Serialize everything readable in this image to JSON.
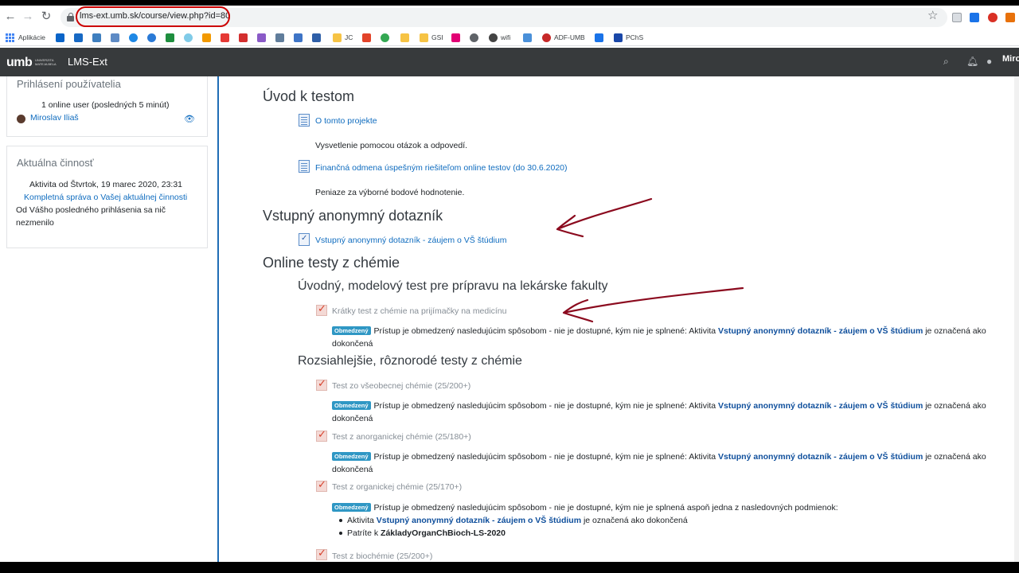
{
  "browser": {
    "url": "lms-ext.umb.sk/course/view.php?id=80",
    "bookmarks": [
      "Aplikácie",
      "JC",
      "GSI",
      "wifi",
      "ADF-UMB",
      "PChS"
    ]
  },
  "navbar": {
    "site_name": "LMS-Ext",
    "logo_text": "umb",
    "logo_sub": "UNIVERZITA MATEJA BELA",
    "user": "Miro"
  },
  "blocks": {
    "login": {
      "title": "Prihlásení používatelia",
      "count": "1 online user (posledných 5 minút)",
      "user": "Miroslav Iliaš"
    },
    "activity": {
      "title": "Aktuálna činnosť",
      "since": "Aktivita od Štvrtok, 19 marec 2020, 23:31",
      "report_link": "Kompletná správa o Vašej aktuálnej činnosti",
      "nothing": "Od Vášho posledného prihlásenia sa nič",
      "nothing2": "nezmenilo"
    }
  },
  "course": {
    "s1": {
      "title": "Úvod k testom",
      "a1": "O tomto projekte",
      "d1": "Vysvetlenie pomocou otázok a odpovedí.",
      "a2": "Finančná odmena úspešným riešiteľom online testov (do 30.6.2020)",
      "d2": "Peniaze za výborné bodové hodnotenie."
    },
    "s2": {
      "title": "Vstupný anonymný dotazník",
      "a1": "Vstupný anonymný dotazník - záujem o VŠ štúdium"
    },
    "s3": {
      "title": "Online testy z chémie",
      "sub1": "Úvodný, modelový test pre prípravu na lekárske fakulty",
      "q1": "Krátky test z chémie na prijímačky na medicínu",
      "sub2": "Rozsiahlejšie, rôznorodé testy z chémie",
      "q2": "Test zo všeobecnej chémie (25/200+)",
      "q3": "Test z anorganickej chémie (25/180+)",
      "q4": "Test z organickej chémie (25/170+)",
      "q5": "Test z biochémie (25/200+)"
    },
    "restrict": {
      "badge": "Obmedzený",
      "pre": "Prístup je obmedzený nasledujúcim spôsobom - nie je dostupné, kým nie je splnené: Aktivita",
      "link": "Vstupný anonymný dotazník - záujem o VŠ štúdium",
      "post": "je označená ako",
      "post2": "dokončená",
      "pre_multi": "Prístup je obmedzený nasledujúcim spôsobom - nie je dostupné, kým nie je splnená aspoň jedna z nasledovných podmienok:",
      "cond1_pre": "Aktivita",
      "cond1_post": "je označená ako dokončená",
      "cond2_pre": "Patríte k",
      "cond2_group": "ZákladyOrganChBioch-LS-2020"
    }
  }
}
